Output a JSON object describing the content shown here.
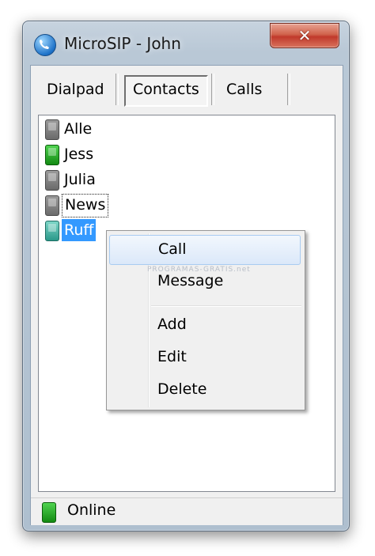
{
  "window": {
    "title": "MicroSIP - John",
    "close_label": "✕"
  },
  "tabs": [
    {
      "label": "Dialpad",
      "selected": false
    },
    {
      "label": "Contacts",
      "selected": true
    },
    {
      "label": "Calls",
      "selected": false
    }
  ],
  "contacts": [
    {
      "name": "Alle",
      "status_color": "grey"
    },
    {
      "name": "Jess",
      "status_color": "green"
    },
    {
      "name": "Julia",
      "status_color": "grey"
    },
    {
      "name": "News",
      "status_color": "grey",
      "focused": true
    },
    {
      "name": "Ruff",
      "status_color": "teal",
      "selected": true
    }
  ],
  "context_menu": {
    "items": [
      "Call",
      "Message",
      "Add",
      "Edit",
      "Delete"
    ],
    "highlighted": "Call"
  },
  "status": {
    "text": "Online",
    "icon": "phone-green-icon"
  },
  "colors": {
    "selection": "#3399ff",
    "online": "#138a13",
    "close_button": "#c0392b"
  },
  "watermark": "PROGRAMAS-GRATIS.net"
}
